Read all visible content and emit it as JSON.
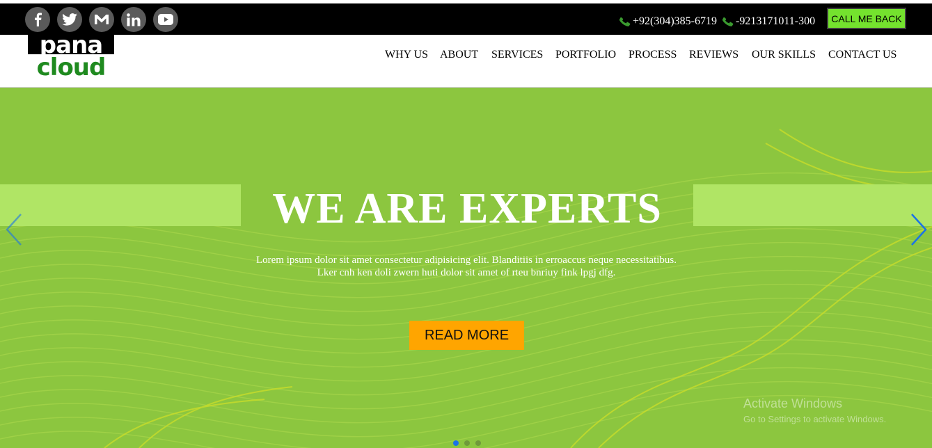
{
  "topbar": {
    "social": [
      {
        "name": "facebook-icon"
      },
      {
        "name": "twitter-icon"
      },
      {
        "name": "gmail-icon"
      },
      {
        "name": "linkedin-icon"
      },
      {
        "name": "youtube-icon"
      }
    ],
    "phone1": "+92(304)385-6719",
    "phone2": "-9213171011-300",
    "call_me_back": "CALL ME BACK"
  },
  "logo": {
    "line1": "pana",
    "line2": "cloud"
  },
  "nav": {
    "items": [
      "WHY US",
      "ABOUT",
      "SERVICES",
      "PORTFOLIO",
      "PROCESS",
      "REVIEWS",
      "OUR SKILLS",
      "CONTACT US"
    ]
  },
  "hero": {
    "title": "WE ARE EXPERTS",
    "text_line1": "Lorem ipsum dolor sit amet consectetur adipisicing elit. Blanditiis in erroaccus neque necessitatibus.",
    "text_line2": "Lker cnh ken doli zwern huti dolor sit amet of rteu bnriuy fink lpgj dfg.",
    "read_more": "READ MORE",
    "active_slide": 1,
    "slide_count": 3
  },
  "watermark": {
    "title": "Activate Windows",
    "subtitle": "Go to Settings to activate Windows."
  },
  "colors": {
    "accent_green": "#74e22e",
    "hero_green": "#8cc63f",
    "band_green": "#b0e565",
    "button_orange": "#ffa500",
    "arrow_blue": "#1a73e8",
    "phone_green": "#3a9a2f",
    "logo_green": "#1f8a1f"
  }
}
